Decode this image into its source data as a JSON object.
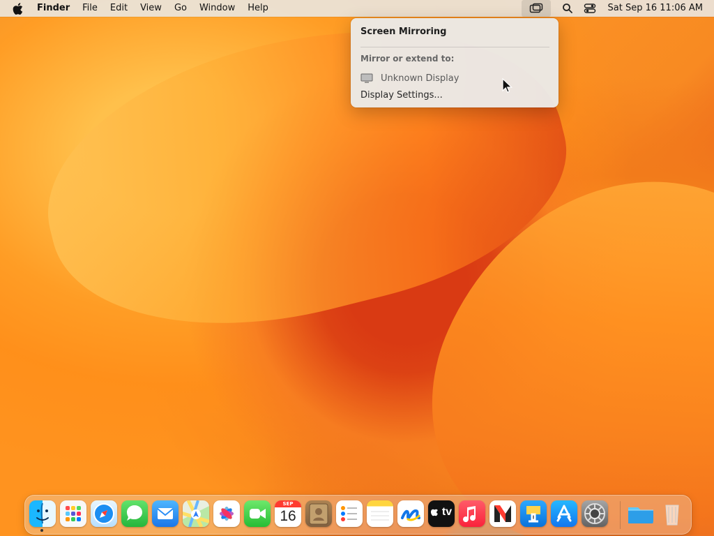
{
  "menubar": {
    "app_name": "Finder",
    "items": [
      "File",
      "Edit",
      "View",
      "Go",
      "Window",
      "Help"
    ],
    "clock": "Sat Sep 16  11:06 AM"
  },
  "popover": {
    "title": "Screen Mirroring",
    "section_label": "Mirror or extend to:",
    "display_name": "Unknown Display",
    "settings_label": "Display Settings..."
  },
  "dock": {
    "calendar_month": "SEP",
    "calendar_day": "16",
    "tv_label": "tv"
  }
}
